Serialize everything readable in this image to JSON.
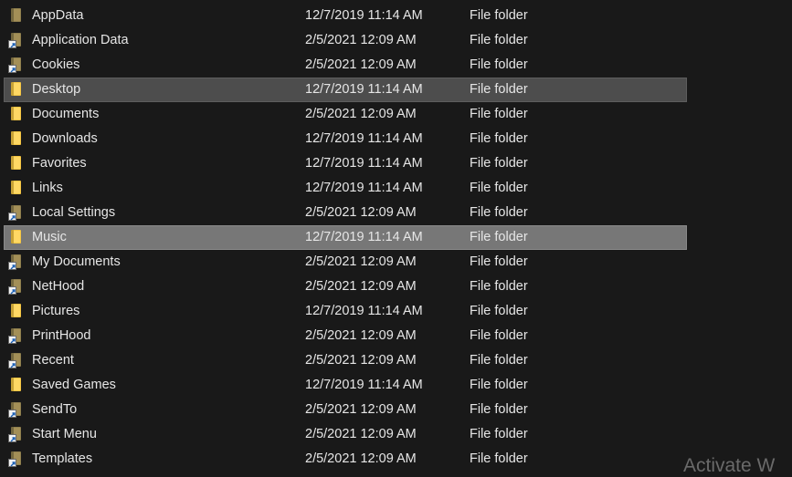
{
  "rows": [
    {
      "name": "AppData",
      "date": "12/7/2019 11:14 AM",
      "type": "File folder",
      "icon": "hidden-folder-icon"
    },
    {
      "name": "Application Data",
      "date": "2/5/2021 12:09 AM",
      "type": "File folder",
      "icon": "folder-shortcut-icon"
    },
    {
      "name": "Cookies",
      "date": "2/5/2021 12:09 AM",
      "type": "File folder",
      "icon": "folder-shortcut-icon"
    },
    {
      "name": "Desktop",
      "date": "12/7/2019 11:14 AM",
      "type": "File folder",
      "icon": "folder-icon"
    },
    {
      "name": "Documents",
      "date": "2/5/2021 12:09 AM",
      "type": "File folder",
      "icon": "folder-icon"
    },
    {
      "name": "Downloads",
      "date": "12/7/2019 11:14 AM",
      "type": "File folder",
      "icon": "folder-icon"
    },
    {
      "name": "Favorites",
      "date": "12/7/2019 11:14 AM",
      "type": "File folder",
      "icon": "folder-icon"
    },
    {
      "name": "Links",
      "date": "12/7/2019 11:14 AM",
      "type": "File folder",
      "icon": "folder-icon"
    },
    {
      "name": "Local Settings",
      "date": "2/5/2021 12:09 AM",
      "type": "File folder",
      "icon": "folder-shortcut-icon"
    },
    {
      "name": "Music",
      "date": "12/7/2019 11:14 AM",
      "type": "File folder",
      "icon": "folder-icon"
    },
    {
      "name": "My Documents",
      "date": "2/5/2021 12:09 AM",
      "type": "File folder",
      "icon": "folder-shortcut-icon"
    },
    {
      "name": "NetHood",
      "date": "2/5/2021 12:09 AM",
      "type": "File folder",
      "icon": "folder-shortcut-icon"
    },
    {
      "name": "Pictures",
      "date": "12/7/2019 11:14 AM",
      "type": "File folder",
      "icon": "folder-icon"
    },
    {
      "name": "PrintHood",
      "date": "2/5/2021 12:09 AM",
      "type": "File folder",
      "icon": "folder-shortcut-icon"
    },
    {
      "name": "Recent",
      "date": "2/5/2021 12:09 AM",
      "type": "File folder",
      "icon": "folder-shortcut-icon"
    },
    {
      "name": "Saved Games",
      "date": "12/7/2019 11:14 AM",
      "type": "File folder",
      "icon": "folder-icon"
    },
    {
      "name": "SendTo",
      "date": "2/5/2021 12:09 AM",
      "type": "File folder",
      "icon": "folder-shortcut-icon"
    },
    {
      "name": "Start Menu",
      "date": "2/5/2021 12:09 AM",
      "type": "File folder",
      "icon": "folder-shortcut-icon"
    },
    {
      "name": "Templates",
      "date": "2/5/2021 12:09 AM",
      "type": "File folder",
      "icon": "folder-shortcut-icon"
    }
  ],
  "watermark": "Activate W",
  "colors": {
    "background": "#191919",
    "text": "#e6e6e6",
    "selected_row": "#4d4d4d",
    "hover_row": "#777777",
    "folder": "#f5c643",
    "hidden_folder": "#8f7f4e"
  }
}
